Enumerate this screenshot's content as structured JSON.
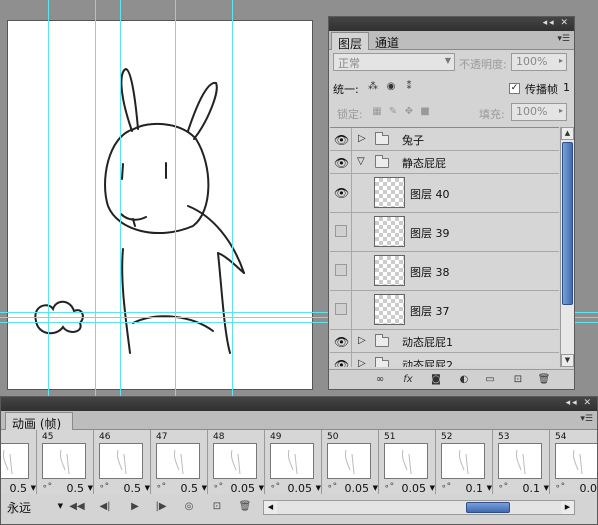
{
  "layers_panel": {
    "tabs": [
      "图层",
      "通道"
    ],
    "blend_mode": "正常",
    "opacity_label": "不透明度:",
    "opacity_value": "100%",
    "unify_label": "统一:",
    "propagate_label": "传播帧",
    "propagate_value": "1",
    "lock_label": "锁定:",
    "fill_label": "填充:",
    "fill_value": "100%",
    "layers": [
      {
        "name": "兔子",
        "type": "group",
        "expanded": false,
        "visible": true
      },
      {
        "name": "静态屁屁",
        "type": "group",
        "expanded": true,
        "visible": true
      },
      {
        "name": "图层 40",
        "type": "layer",
        "visible": true
      },
      {
        "name": "图层 39",
        "type": "layer",
        "visible": false
      },
      {
        "name": "图层 38",
        "type": "layer",
        "visible": false
      },
      {
        "name": "图层 37",
        "type": "layer",
        "visible": false
      },
      {
        "name": "动态屁屁1",
        "type": "group",
        "expanded": false,
        "visible": true
      },
      {
        "name": "动态屁屁2",
        "type": "group",
        "expanded": false,
        "visible": true
      }
    ]
  },
  "animation_panel": {
    "tab": "动画 (帧)",
    "loop": "永远",
    "frames": [
      {
        "num": "",
        "time": "0.5"
      },
      {
        "num": "45",
        "time": "0.5"
      },
      {
        "num": "46",
        "time": "0.5"
      },
      {
        "num": "47",
        "time": "0.5"
      },
      {
        "num": "48",
        "time": "0.05"
      },
      {
        "num": "49",
        "time": "0.05"
      },
      {
        "num": "50",
        "time": "0.05"
      },
      {
        "num": "51",
        "time": "0.05"
      },
      {
        "num": "52",
        "time": "0.1"
      },
      {
        "num": "53",
        "time": "0.1"
      },
      {
        "num": "54",
        "time": "0.0"
      }
    ]
  }
}
